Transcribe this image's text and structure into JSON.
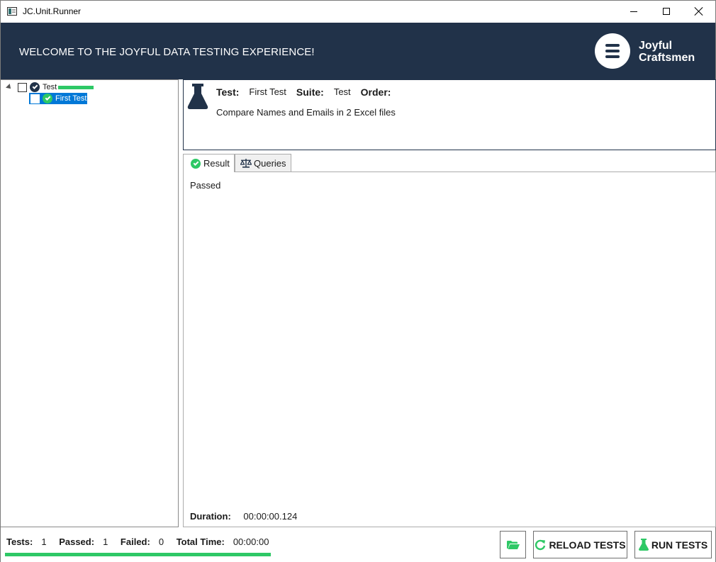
{
  "window": {
    "title": "JC.Unit.Runner"
  },
  "banner": {
    "welcome": "WELCOME TO THE JOYFUL DATA TESTING EXPERIENCE!",
    "logo_line1": "Joyful",
    "logo_line2": "Craftsmen",
    "background_color": "#213249"
  },
  "tree": {
    "root": {
      "label": "Test",
      "status": "passed",
      "icon": "check-circle-icon"
    },
    "children": [
      {
        "label": "First Test",
        "status": "passed",
        "selected": true,
        "icon": "check-circle-icon"
      }
    ]
  },
  "info": {
    "test_label": "Test:",
    "test_value": "First Test",
    "suite_label": "Suite:",
    "suite_value": "Test",
    "order_label": "Order:",
    "order_value": "",
    "description": "Compare Names and Emails in 2 Excel files",
    "icon": "flask-icon"
  },
  "tabs": [
    {
      "label": "Result",
      "icon": "check-circle-icon",
      "active": true
    },
    {
      "label": "Queries",
      "icon": "scale-icon",
      "active": false
    }
  ],
  "result": {
    "text": "Passed",
    "duration_label": "Duration:",
    "duration_value": "00:00:00.124"
  },
  "status": {
    "tests_label": "Tests:",
    "tests_value": "1",
    "passed_label": "Passed:",
    "passed_value": "1",
    "failed_label": "Failed:",
    "failed_value": "0",
    "time_label": "Total Time:",
    "time_value": "00:00:00",
    "progress": 1.0,
    "progress_color": "#2ec866"
  },
  "buttons": {
    "open_folder_icon": "folder-open-icon",
    "reload_label": "RELOAD TESTS",
    "run_label": "RUN TESTS"
  }
}
